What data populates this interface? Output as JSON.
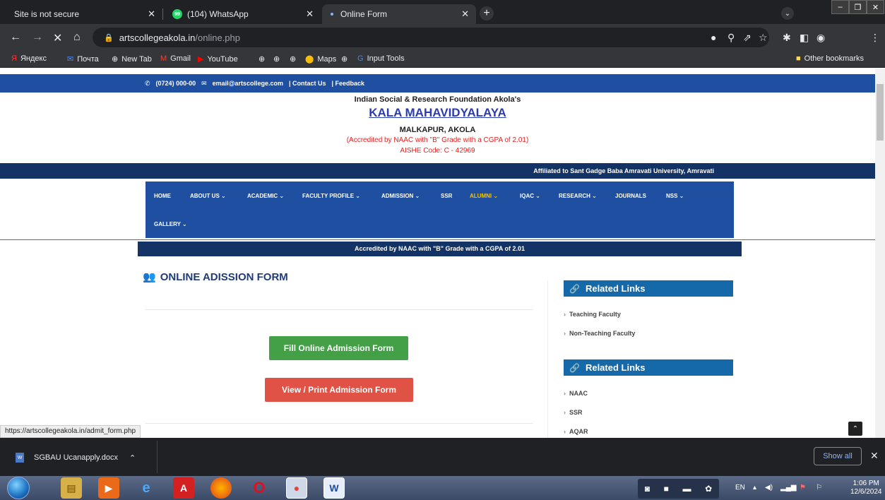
{
  "tabs": [
    {
      "title": "Site is not secure"
    },
    {
      "title": "(104) WhatsApp",
      "badge": "99"
    },
    {
      "title": "Online Form"
    }
  ],
  "omnibox": {
    "host": "artscollegeakola.in",
    "path": "/online.php"
  },
  "bookmarks": [
    "Яндекс",
    "Почта",
    "New Tab",
    "Gmail",
    "YouTube",
    "Maps",
    "Input Tools"
  ],
  "other_bookmarks": "Other bookmarks",
  "site": {
    "phone": "(0724) 000-00",
    "email": "email@artscollege.com",
    "contact": "| Contact Us",
    "feedback": "| Feedback",
    "institution": "Indian Social & Research Foundation Akola's",
    "college_name": "KALA MAHAVIDYALAYA",
    "place": "MALKAPUR, AKOLA",
    "accreditation": "(Accredited by NAAC with \"B\" Grade with a CGPA of 2.01)",
    "aishe": "AISHE Code: C - 42969",
    "affiliation": "Affiliated to Sant Gadge Baba Amravati University, Amravati",
    "naac_bar": "Accredited by NAAC with \"B\" Grade with a CGPA of 2.01"
  },
  "nav": {
    "home": "HOME",
    "about": "ABOUT US ⌄",
    "academic": "ACADEMIC ⌄",
    "faculty": "FACULTY PROFILE ⌄",
    "admission": "ADMISSION ⌄",
    "ssr": "SSR",
    "alumni": "ALUMNI ⌄",
    "iqac": "IQAC ⌄",
    "research": "RESEARCH ⌄",
    "journals": "JOURNALS",
    "nss": "NSS ⌄",
    "gallery": "GALLERY ⌄"
  },
  "form": {
    "title": "ONLINE ADISSION FORM",
    "fill_button": "Fill Online Admission Form",
    "view_button": "View / Print Admission Form"
  },
  "sidebar": {
    "heading1": "Related Links",
    "links1": [
      "Teaching Faculty",
      "Non-Teaching Faculty"
    ],
    "heading2": "Related Links",
    "links2": [
      "NAAC",
      "SSR",
      "AQAR"
    ]
  },
  "status_url": "https://artscollegeakola.in/admit_form.php",
  "download": {
    "file": "SGBAU Ucanapply.docx",
    "show_all": "Show all"
  },
  "taskbar": {
    "lang": "EN",
    "time": "1:06 PM",
    "date": "12/6/2024"
  }
}
